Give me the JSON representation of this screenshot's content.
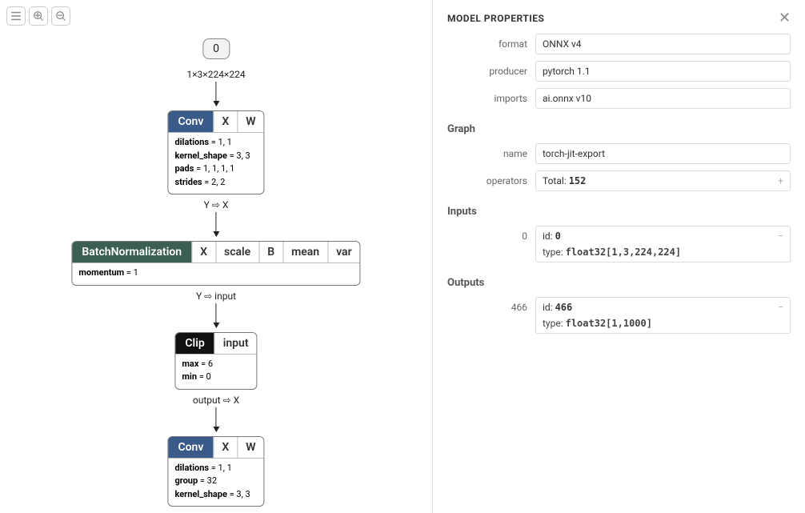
{
  "toolbar": {
    "menu_tooltip": "Menu",
    "zoom_in_tooltip": "Zoom In",
    "zoom_out_tooltip": "Zoom Out"
  },
  "graph": {
    "input": {
      "label": "0",
      "shape_label": "1×3×224×224"
    },
    "nodes": [
      {
        "op": "Conv",
        "op_class": "op-conv",
        "ports": [
          "X",
          "W"
        ],
        "attrs": [
          {
            "k": "dilations",
            "v": "1, 1"
          },
          {
            "k": "kernel_shape",
            "v": "3, 3"
          },
          {
            "k": "pads",
            "v": "1, 1, 1, 1"
          },
          {
            "k": "strides",
            "v": "2, 2"
          }
        ],
        "out_label": "Y ⇨ X"
      },
      {
        "op": "BatchNormalization",
        "op_class": "op-bn",
        "ports": [
          "X",
          "scale",
          "B",
          "mean",
          "var"
        ],
        "attrs": [
          {
            "k": "momentum",
            "v": "1"
          }
        ],
        "out_label": "Y ⇨ input"
      },
      {
        "op": "Clip",
        "op_class": "op-clip",
        "ports": [
          "input"
        ],
        "attrs": [
          {
            "k": "max",
            "v": "6"
          },
          {
            "k": "min",
            "v": "0"
          }
        ],
        "out_label": "output ⇨ X"
      },
      {
        "op": "Conv",
        "op_class": "op-conv",
        "ports": [
          "X",
          "W"
        ],
        "attrs": [
          {
            "k": "dilations",
            "v": "1, 1"
          },
          {
            "k": "group",
            "v": "32"
          },
          {
            "k": "kernel_shape",
            "v": "3, 3"
          }
        ],
        "out_label": ""
      }
    ]
  },
  "sidebar": {
    "title": "MODEL PROPERTIES",
    "model": {
      "format_label": "format",
      "format": "ONNX v4",
      "producer_label": "producer",
      "producer": "pytorch 1.1",
      "imports_label": "imports",
      "imports": "ai.onnx v10"
    },
    "graph_section": "Graph",
    "graph": {
      "name_label": "name",
      "name": "torch-jit-export",
      "operators_label": "operators",
      "operators_prefix": "Total: ",
      "operators_total": "152"
    },
    "inputs_section": "Inputs",
    "inputs": [
      {
        "slot": "0",
        "id_label": "id: ",
        "id": "0",
        "type_label": "type: ",
        "type": "float32[1,3,224,224]"
      }
    ],
    "outputs_section": "Outputs",
    "outputs": [
      {
        "slot": "466",
        "id_label": "id: ",
        "id": "466",
        "type_label": "type: ",
        "type": "float32[1,1000]"
      }
    ]
  }
}
